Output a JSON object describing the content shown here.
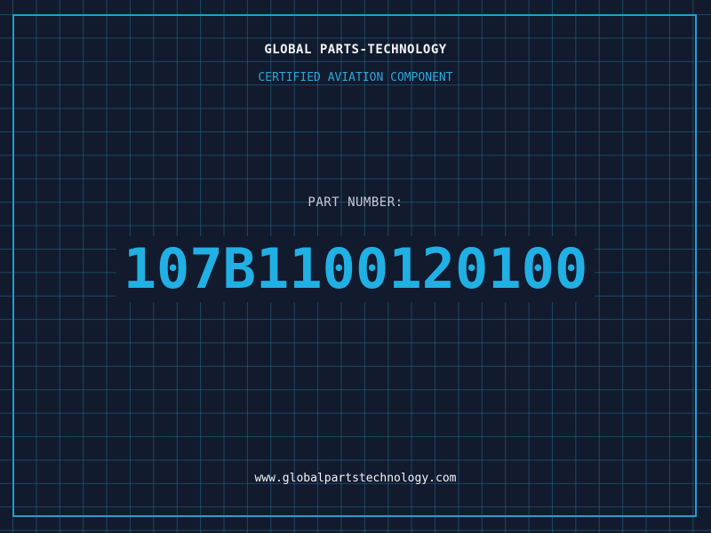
{
  "header": {
    "company": "GLOBAL PARTS-TECHNOLOGY",
    "tagline": "CERTIFIED AVIATION COMPONENT"
  },
  "part": {
    "label": "PART NUMBER:",
    "number": "107B1100120100"
  },
  "footer": {
    "website": "www.globalpartstechnology.com"
  },
  "colors": {
    "background": "#121a2e",
    "grid": "#226e8c",
    "accent": "#21b0e3",
    "text": "#f2f4f8"
  }
}
